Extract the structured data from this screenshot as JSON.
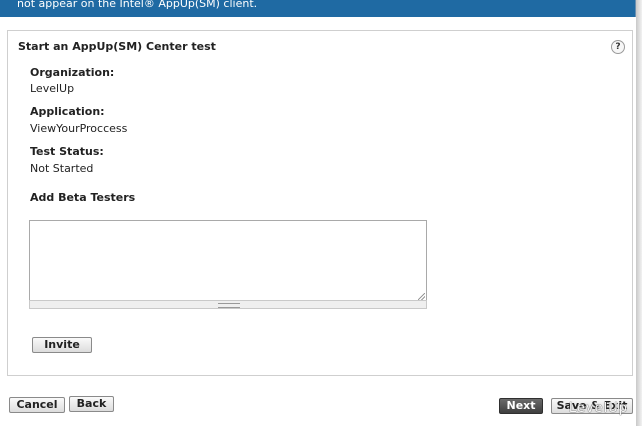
{
  "banner": {
    "text": "not appear on the Intel® AppUp(SM) client."
  },
  "panel": {
    "title": "Start an AppUp(SM) Center test",
    "help_symbol": "?",
    "organization_label": "Organization:",
    "organization_value": "LevelUp",
    "application_label": "Application:",
    "application_value": "ViewYourProccess",
    "status_label": "Test Status:",
    "status_value": "Not Started",
    "testers_label": "Add Beta Testers",
    "testers_value": "",
    "invite_label": "Invite"
  },
  "footer": {
    "cancel_label": "Cancel",
    "back_label": "Back",
    "next_label": "Next",
    "save_exit_label": "Save & Exit"
  },
  "watermark": "LevelUp",
  "colors": {
    "banner": "#1f6aa3",
    "dark_button": "#4a4a4a"
  }
}
